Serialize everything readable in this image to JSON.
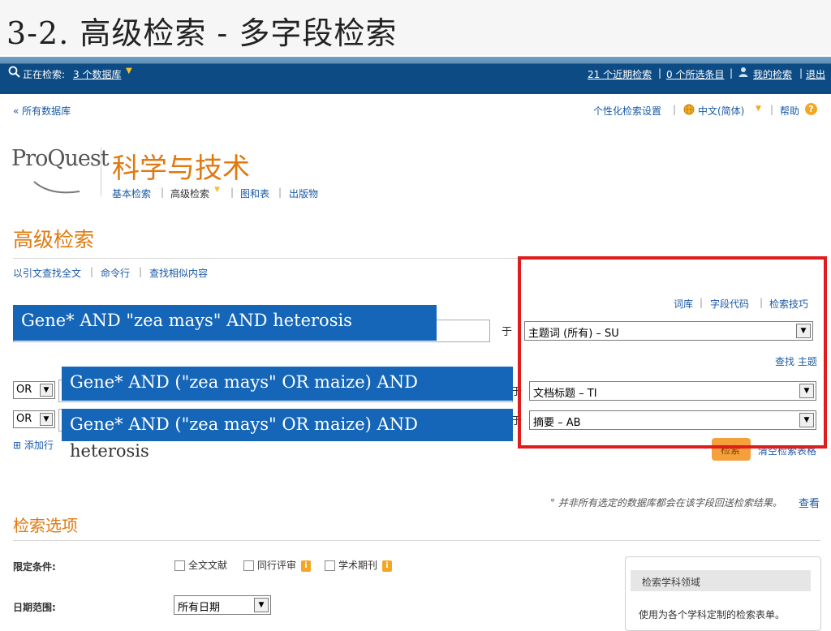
{
  "slide": {
    "title": "3-2. 高级检索  - 多字段检索"
  },
  "topbar": {
    "searching_label": "正在检索:",
    "db_count": "3 个数据库",
    "recent_searches": "21 个近期检索",
    "selected_items": "0 个所选条目",
    "my_research": "我的检索",
    "logout": "退出",
    "sep": "|"
  },
  "subnav": {
    "all_databases": "« 所有数据库",
    "personalize": "个性化检索设置",
    "language": "中文(简体)",
    "help": "帮助",
    "help_icon": "?"
  },
  "brand": {
    "logo": "ProQuest",
    "product": "科学与技术",
    "nav": [
      "基本检索",
      "高级检索",
      "图和表",
      "出版物"
    ]
  },
  "advanced": {
    "title": "高级检索",
    "links": [
      "以引文查找全文",
      "命令行",
      "查找相似内容"
    ],
    "tools": [
      "词库",
      "字段代码",
      "检索技巧"
    ],
    "find_subject": "查找 主题",
    "in_label": "于",
    "rows": [
      {
        "query": "Gene* AND \"zea mays\" AND heterosis",
        "field": "主题词 (所有) – SU"
      },
      {
        "operator": "OR",
        "query": "Gene* AND (\"zea mays\" OR maize) AND",
        "field": "文档标题 – TI"
      },
      {
        "operator": "OR",
        "query": "Gene* AND (\"zea mays\" OR maize) AND",
        "field": "摘要 – AB"
      }
    ],
    "overflow_text": "heterosis",
    "add_row": "⊞ 添加行",
    "search_button": "检索",
    "clear_form": "清空检索表格",
    "note": "° 并非所有选定的数据库都会在该字段回送检索结果。",
    "note_link": "查看"
  },
  "options": {
    "title": "检索选项",
    "limits_label": "限定条件:",
    "limits": [
      "全文文献",
      "同行评审",
      "学术期刊"
    ],
    "info_badge": "i",
    "date_label": "日期范围:",
    "date_value": "所有日期"
  },
  "subject_panel": {
    "title": "检索学科领域",
    "text": "使用为各个学科定制的检索表单。"
  },
  "colors": {
    "accent_orange": "#e07a10",
    "topbar_blue": "#0d4b85",
    "overlay_blue": "#1566b8",
    "highlight_red": "#e11c1c"
  }
}
